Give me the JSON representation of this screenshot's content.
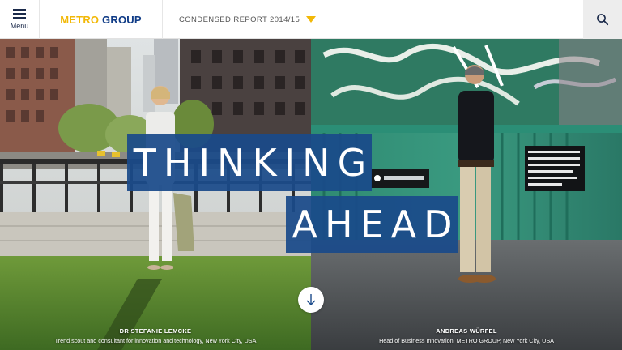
{
  "header": {
    "menu_label": "Menu",
    "menu_icon": "hamburger-icon",
    "logo_metro": "METRO",
    "logo_group": " GROUP",
    "report_label": "CONDENSED REPORT 2014/15",
    "report_caret_icon": "caret-down-icon",
    "search_icon": "search-icon",
    "accent_color": "#f2b807",
    "brand_color": "#0f3b86"
  },
  "hero": {
    "headline_line1": "THINKING",
    "headline_line2": "AHEAD",
    "headline_bg": "#1a4a8a",
    "scroll_icon": "arrow-down-icon",
    "left": {
      "name": "DR STEFANIE LEMCKE",
      "role": "Trend scout and consultant for innovation and technology, New York City, USA"
    },
    "right": {
      "name": "ANDREAS WÜRFEL",
      "role": "Head of Business Innovation, METRO GROUP, New York City, USA"
    }
  }
}
